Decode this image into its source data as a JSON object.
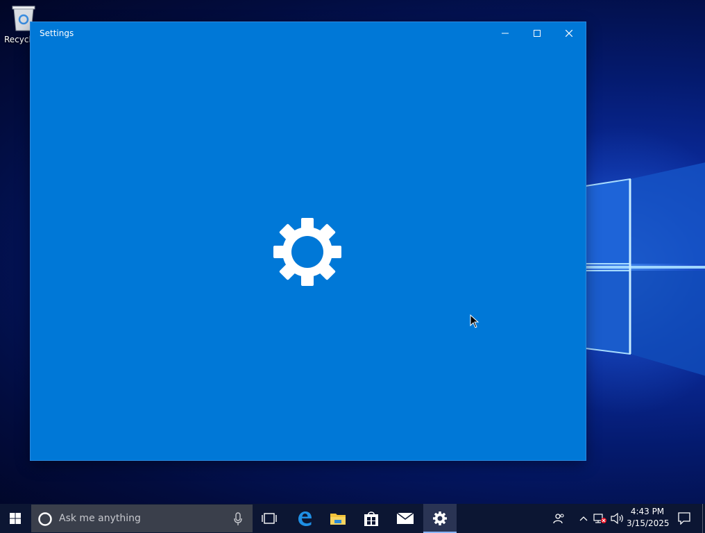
{
  "desktop": {
    "icons": [
      {
        "label": "Recycle",
        "icon": "recycle-bin-icon"
      }
    ]
  },
  "window": {
    "title": "Settings",
    "splash_icon": "gear-icon",
    "controls": {
      "minimize": "minimize-icon",
      "maximize": "maximize-icon",
      "close": "close-icon"
    },
    "background": "#0078d7"
  },
  "taskbar": {
    "search": {
      "placeholder": "Ask me anything"
    },
    "pinned": [
      {
        "name": "task-view",
        "icon": "task-view-icon"
      },
      {
        "name": "edge",
        "icon": "edge-icon"
      },
      {
        "name": "file-explorer",
        "icon": "folder-icon"
      },
      {
        "name": "store",
        "icon": "store-icon"
      },
      {
        "name": "mail",
        "icon": "mail-icon"
      },
      {
        "name": "settings",
        "icon": "gear-icon",
        "active": true
      }
    ],
    "tray": {
      "time": "4:43 PM",
      "date": "3/15/2025"
    },
    "background": "#0c1633"
  }
}
